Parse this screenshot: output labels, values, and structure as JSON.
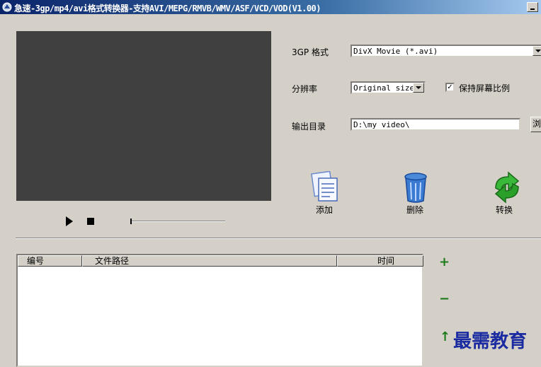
{
  "window": {
    "title": "急速-3gp/mp4/avi格式转换器-支持AVI/MEPG/RMVB/WMV/ASF/VCD/VOD(V1.00)"
  },
  "form": {
    "format_label": "3GP 格式",
    "format_value": "DivX Movie (*.avi)",
    "resolution_label": "分辨率",
    "resolution_value": "Original size",
    "keep_ratio_label": "保持屏幕比例",
    "keep_ratio_checked": true,
    "output_label": "输出目录",
    "output_value": "D:\\my video\\",
    "browse_label": "浏"
  },
  "actions": {
    "add_label": "添加",
    "delete_label": "删除",
    "convert_label": "转换"
  },
  "table": {
    "columns": [
      "编号",
      "文件路径",
      "时间"
    ],
    "rows": []
  },
  "side_controls": {
    "add_symbol": "+",
    "remove_symbol": "−",
    "up_symbol": "↑"
  },
  "watermark": "最需教育",
  "colors": {
    "titlebar": "#0a246a",
    "window_bg": "#d4d0c8",
    "video_bg": "#404040",
    "watermark": "#1a2aa0",
    "side_icons": "#1a7a1a"
  }
}
